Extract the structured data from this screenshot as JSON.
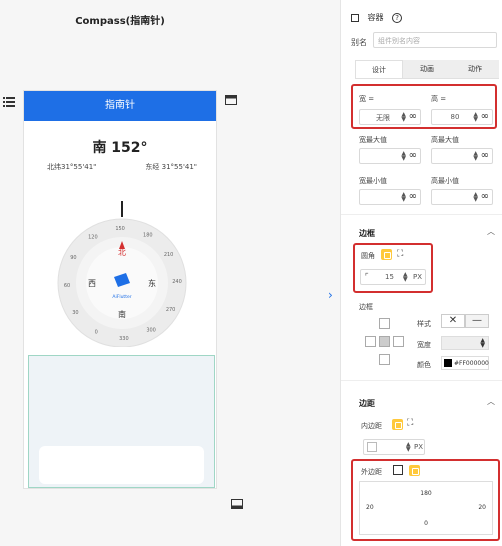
{
  "canvas": {
    "title": "Compass(指南针)",
    "app_bar_title": "指南针",
    "heading": "南 152°",
    "lat": "北纬31°55'41\"",
    "lon": "东经 31°55'41\"",
    "compass": {
      "ticks": [
        "0",
        "30",
        "60",
        "90",
        "120",
        "150",
        "180",
        "210",
        "240",
        "270",
        "300",
        "330"
      ],
      "north": "北",
      "south": "南",
      "east": "东",
      "west": "西",
      "brand": "AiFlutter"
    }
  },
  "panel": {
    "container_label": "容器",
    "alias_label": "别名",
    "alias_placeholder": "组件别名内容",
    "tabs": [
      "设计",
      "动画",
      "动作"
    ],
    "width_label": "宽 =",
    "height_label": "高 =",
    "width_value": "无限",
    "height_value": "80",
    "min_width_label": "宽最大值",
    "max_height_label": "高最大值",
    "min_w_label": "宽最小值",
    "min_h_label": "高最小值",
    "border_section": "边框",
    "radius_label": "圆角",
    "radius_value": "15",
    "radius_unit": "PX",
    "border_label": "边框",
    "style_label": "样式",
    "width2_label": "宽度",
    "color_label": "颜色",
    "color_value": "#FF000000",
    "margin_section": "边距",
    "padding_label": "内边距",
    "padding_unit": "PX",
    "outer_label": "外边距",
    "outer_values": {
      "top": "180",
      "left": "20",
      "right": "20",
      "bottom": "0"
    }
  }
}
